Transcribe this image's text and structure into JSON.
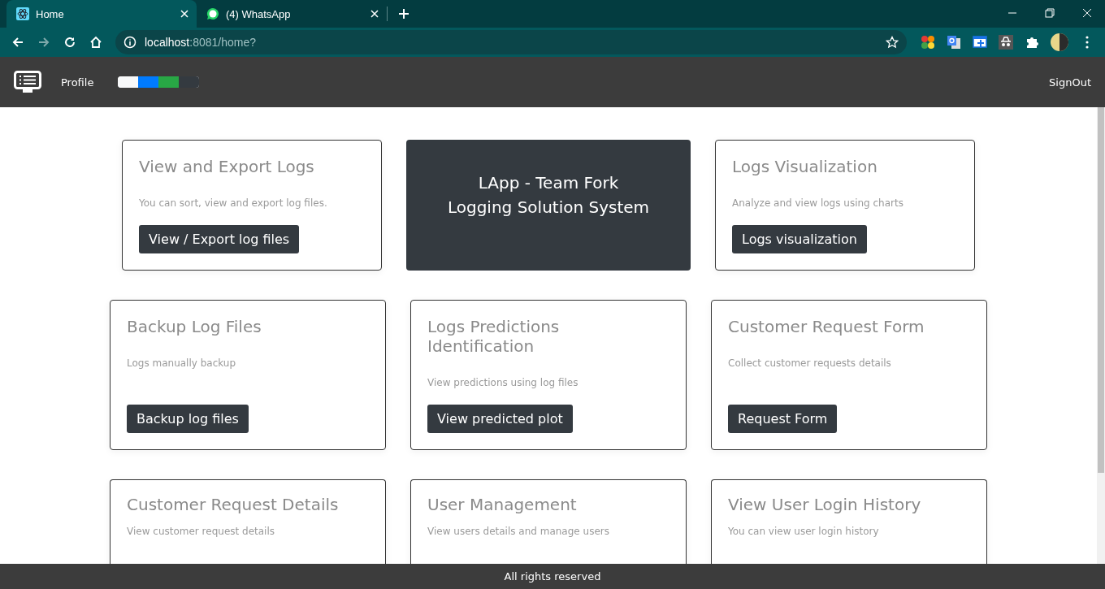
{
  "browser": {
    "tabs": [
      {
        "title": "Home",
        "selected": true,
        "kind": "app"
      },
      {
        "title": "(4) WhatsApp",
        "selected": false,
        "kind": "messenger"
      }
    ],
    "address": {
      "host": "localhost",
      "rest": ":8081/home?"
    }
  },
  "navbar": {
    "profile": "Profile",
    "progress": [
      {
        "color": "#f8f9fa"
      },
      {
        "color": "#007bff"
      },
      {
        "color": "#28a745"
      },
      {
        "color": "#343a40"
      }
    ],
    "signout": "SignOut"
  },
  "rows": [
    [
      {
        "kind": "card",
        "title": "View and Export Logs",
        "text": "You can sort, view and export log files.",
        "button": "View / Export log files"
      },
      {
        "kind": "banner",
        "lines": [
          "LApp - Team Fork",
          "Logging Solution System"
        ]
      },
      {
        "kind": "card",
        "title": "Logs Visualization",
        "text": "Analyze and view logs using charts",
        "button": "Logs visualization"
      }
    ],
    [
      {
        "kind": "card",
        "title": "Backup Log Files",
        "text": "Logs manually backup",
        "button": "Backup log files"
      },
      {
        "kind": "card",
        "title": "Logs Predictions Identification",
        "text": "View predictions using log files",
        "button": "View predicted plot"
      },
      {
        "kind": "card",
        "title": "Customer Request Form",
        "text": "Collect customer requests details",
        "button": "Request Form"
      }
    ],
    [
      {
        "kind": "card",
        "title": "Customer Request Details",
        "text": "View customer request details"
      },
      {
        "kind": "card",
        "title": "User Management",
        "text": "View users details and manage users"
      },
      {
        "kind": "card",
        "title": "View User Login History",
        "text": "You can view user login history"
      }
    ]
  ],
  "footer": "All rights reserved"
}
